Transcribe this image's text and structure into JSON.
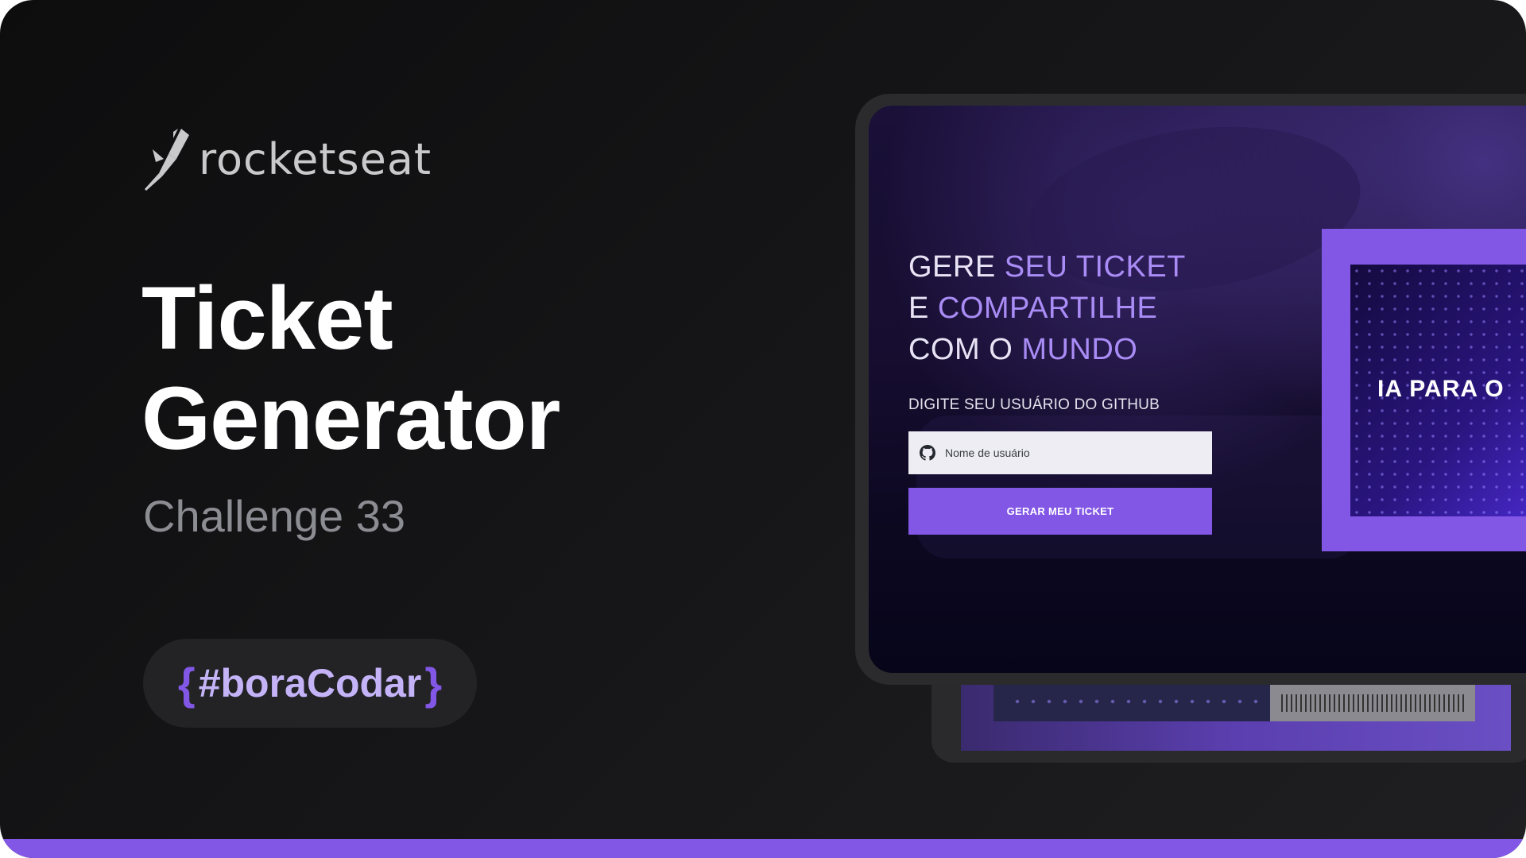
{
  "brand": {
    "logo_text": "rocketseat"
  },
  "hero": {
    "title_line1": "Ticket",
    "title_line2": "Generator",
    "subtitle": "Challenge 33"
  },
  "badge": {
    "brace_open": "{",
    "text": "#boraCodar",
    "brace_close": "}"
  },
  "mockup": {
    "headline": {
      "line1_a": "GERE ",
      "line1_b": "SEU TICKET",
      "line2_a": "E ",
      "line2_b": "COMPARTILHE",
      "line3_a": "COM O ",
      "line3_b": "MUNDO"
    },
    "input_label": "DIGITE SEU USUÁRIO DO GITHUB",
    "input_placeholder": "Nome de usuário",
    "button_label": "GERAR MEU TICKET",
    "ticket_text": "IA PARA O"
  },
  "colors": {
    "accent": "#8257e5",
    "accent_light": "#a98cf5",
    "background": "#121214"
  },
  "icons": [
    "rocket-logo-icon",
    "github-icon"
  ]
}
